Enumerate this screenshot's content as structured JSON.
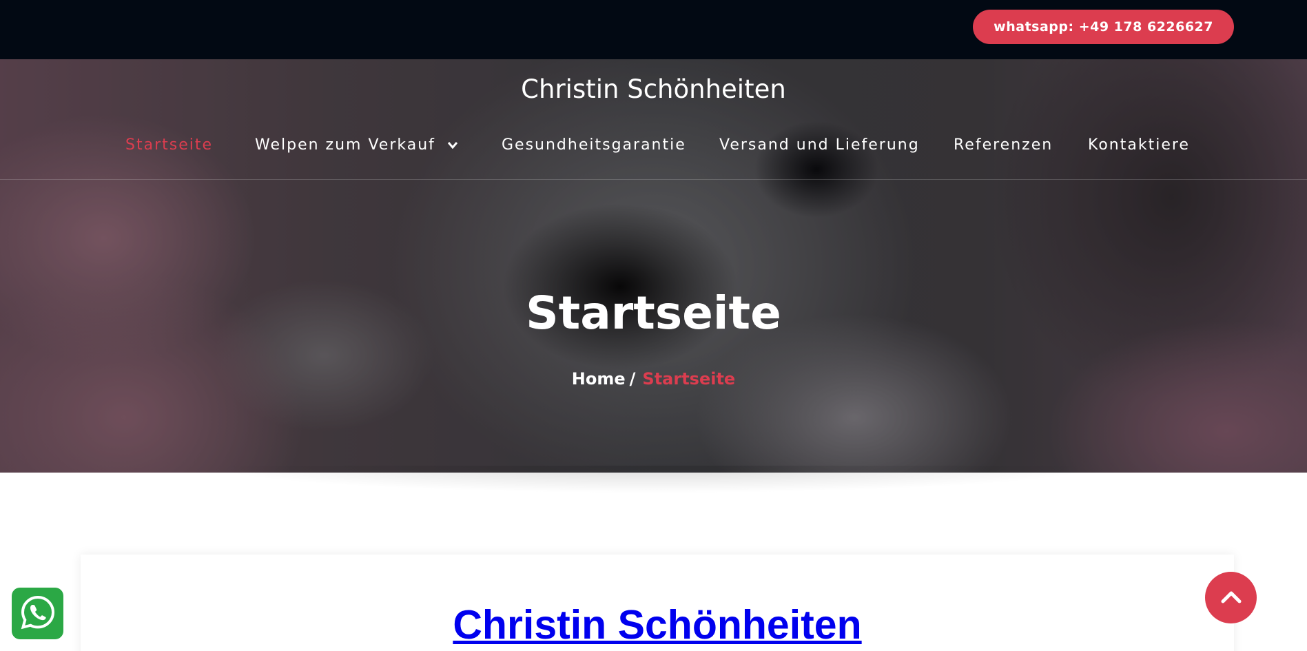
{
  "topbar": {
    "whatsapp_label": "whatsapp: +49 178 6226627"
  },
  "header": {
    "site_title": "Christin Schönheiten"
  },
  "nav": {
    "items": [
      {
        "label": "Startseite",
        "active": true
      },
      {
        "label": "Welpen zum Verkauf",
        "has_dropdown": true
      },
      {
        "label": "Gesundheitsgarantie"
      },
      {
        "label": "Versand und Lieferung"
      },
      {
        "label": "Referenzen"
      },
      {
        "label": "Kontaktiere"
      }
    ]
  },
  "hero": {
    "heading": "Startseite",
    "breadcrumb": {
      "home": "Home",
      "separator": "/",
      "current": "Startseite"
    }
  },
  "content": {
    "title": "Christin Schönheiten"
  },
  "icons": {
    "whatsapp_float": "whatsapp-icon",
    "back_to_top": "chevron-up-icon",
    "dropdown": "chevron-down-icon"
  },
  "colors": {
    "accent": "#dc3d4f",
    "topbar": "#020913",
    "whatsapp_green": "#2ba845",
    "link": "#0000ee"
  }
}
